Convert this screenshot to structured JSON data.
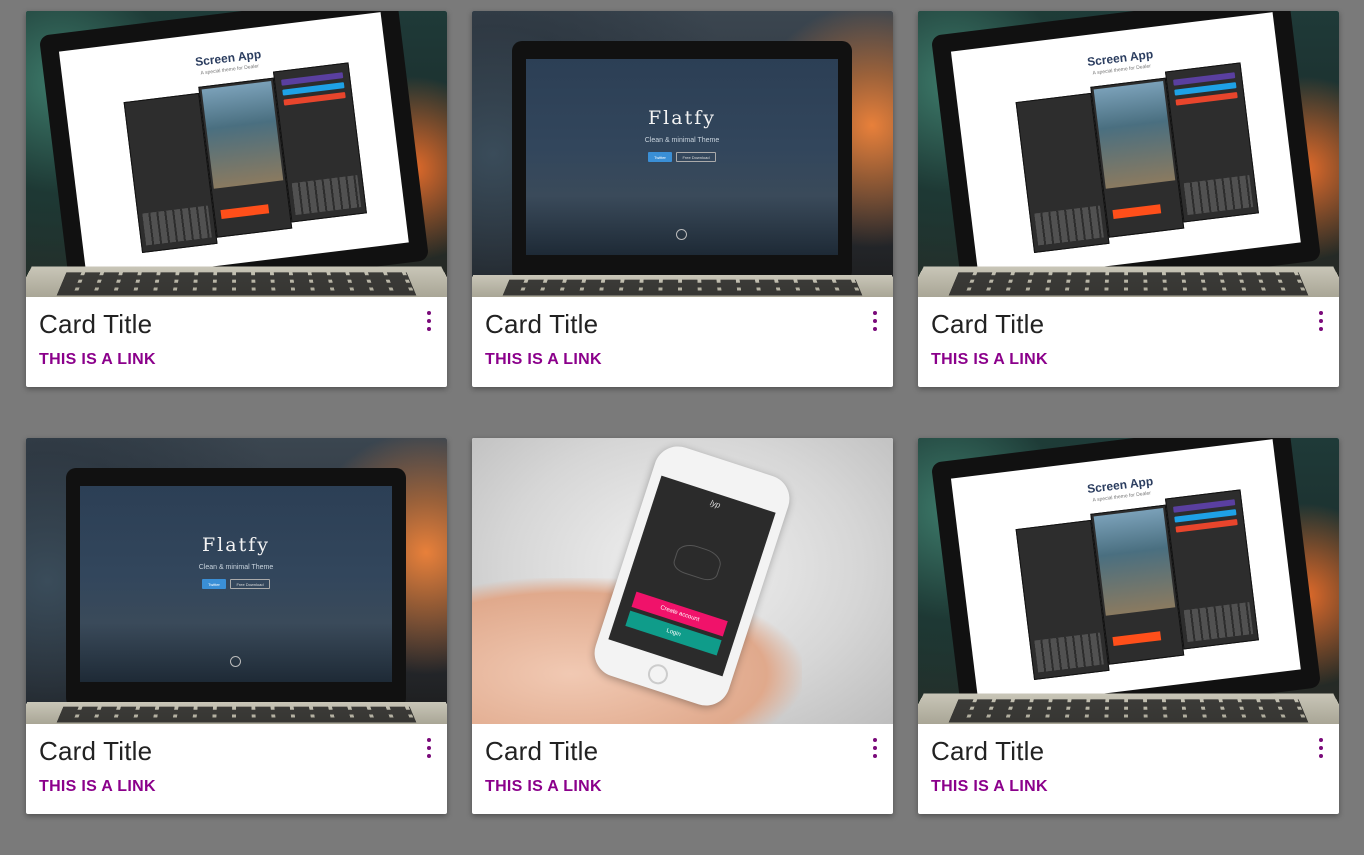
{
  "cards": [
    {
      "image": "screen-app",
      "title": "Card Title",
      "link": "THIS IS A LINK"
    },
    {
      "image": "flatfy",
      "title": "Card Title",
      "link": "THIS IS A LINK"
    },
    {
      "image": "screen-app",
      "title": "Card Title",
      "link": "THIS IS A LINK"
    },
    {
      "image": "flatfy",
      "title": "Card Title",
      "link": "THIS IS A LINK"
    },
    {
      "image": "phone-app",
      "title": "Card Title",
      "link": "THIS IS A LINK"
    },
    {
      "image": "screen-app",
      "title": "Card Title",
      "link": "THIS IS A LINK"
    }
  ],
  "screen_app": {
    "title": "Screen App",
    "subtitle": "A special theme for Dealer"
  },
  "flatfy": {
    "title": "Flatfy",
    "subtitle": "Clean & minimal Theme",
    "button_primary": "Twitter",
    "button_secondary": "Free Download"
  },
  "phone_app": {
    "logo": "lyp",
    "button_create": "Create account",
    "button_login": "Login"
  },
  "colors": {
    "page_background": "#7a7a7a",
    "link": "#8b008b",
    "more_icon": "#7a0a7a"
  },
  "icons": {
    "card_menu": "more-vert-icon"
  }
}
